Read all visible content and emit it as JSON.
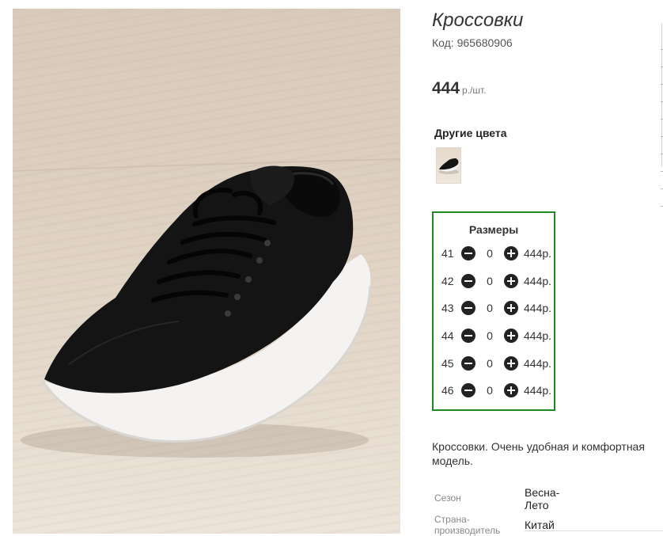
{
  "product": {
    "title": "Кроссовки",
    "code": "Код: 965680906",
    "price_value": "444",
    "price_unit": "р./шт.",
    "description": "Кроссовки. Очень удобная и комфортная модель."
  },
  "other_colors": {
    "heading": "Другие цвета"
  },
  "sizes": {
    "heading": "Размеры",
    "rows": [
      {
        "size": "41",
        "qty": "0",
        "price": "444р."
      },
      {
        "size": "42",
        "qty": "0",
        "price": "444р."
      },
      {
        "size": "43",
        "qty": "0",
        "price": "444р."
      },
      {
        "size": "44",
        "qty": "0",
        "price": "444р."
      },
      {
        "size": "45",
        "qty": "0",
        "price": "444р."
      },
      {
        "size": "46",
        "qty": "0",
        "price": "444р."
      }
    ]
  },
  "properties": [
    {
      "label": "Сезон",
      "value": "Весна-Лето"
    },
    {
      "label": "Страна-производитель",
      "value": "Китай"
    }
  ],
  "icons": {
    "decrease": "minus-circle-icon",
    "increase": "plus-circle-icon"
  },
  "colors": {
    "accent_border": "#1f8a1f",
    "text": "#333333",
    "button": "#222222"
  }
}
